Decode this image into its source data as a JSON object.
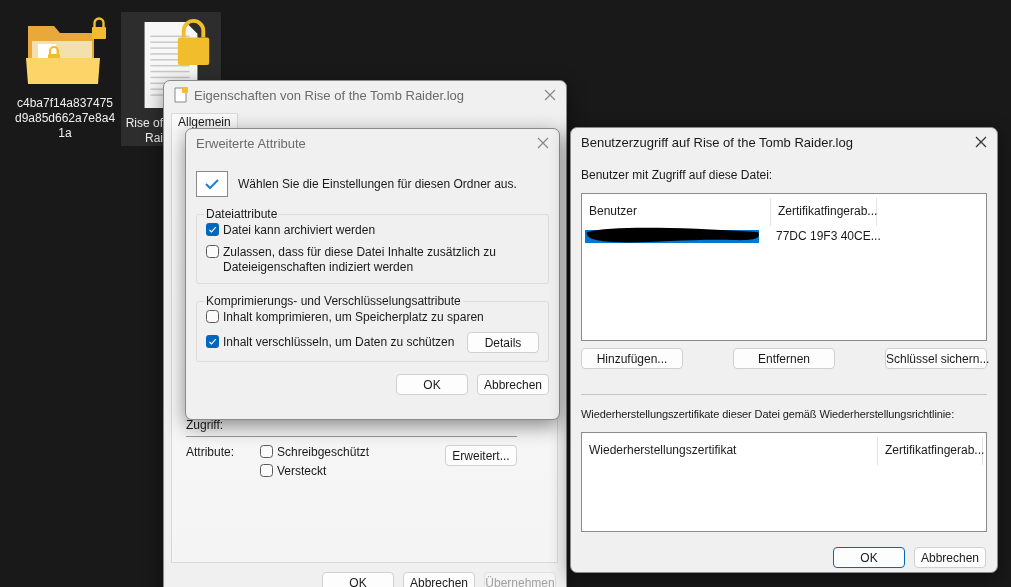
{
  "desktop": {
    "icons": [
      {
        "kind": "folder",
        "label_lines": [
          "c4ba7f14a837475",
          "d9a85d662a7e8a4",
          "1a"
        ],
        "selected": false
      },
      {
        "kind": "file",
        "label_lines": [
          "Rise of",
          "Rai"
        ],
        "selected": true
      }
    ]
  },
  "properties": {
    "title": "Eigenschaften von Rise of the Tomb Raider.log",
    "tabs": [
      {
        "label": "Allgemein",
        "selected": true
      }
    ],
    "access_label": "Zugriff:",
    "attributes_label": "Attribute:",
    "checkboxes": [
      {
        "label": "Schreibgeschützt",
        "checked": false
      },
      {
        "label": "Versteckt",
        "checked": false
      }
    ],
    "advanced_button": "Erweitert...",
    "buttons": [
      {
        "label": "OK",
        "disabled": false
      },
      {
        "label": "Abbrechen",
        "disabled": false
      },
      {
        "label": "Übernehmen",
        "disabled": true
      }
    ]
  },
  "advanced": {
    "title": "Erweiterte Attribute",
    "intro": "Wählen Sie die Einstellungen für diesen Ordner aus.",
    "groups": [
      {
        "title": "Dateiattribute",
        "options": [
          {
            "label": "Datei kann archiviert werden",
            "checked": true
          },
          {
            "label": "Zulassen, dass für diese Datei Inhalte zusätzlich zu Dateieigenschaften indiziert werden",
            "checked": false
          }
        ]
      },
      {
        "title": "Komprimierungs- und Verschlüsselungsattribute",
        "options": [
          {
            "label": "Inhalt komprimieren, um Speicherplatz zu sparen",
            "checked": false
          },
          {
            "label": "Inhalt verschlüsseln, um Daten zu schützen",
            "checked": true,
            "button": "Details"
          }
        ]
      }
    ],
    "buttons": [
      "OK",
      "Abbrechen"
    ]
  },
  "user_access": {
    "title": "Benutzerzugriff auf Rise of the Tomb Raider.log",
    "users_label": "Benutzer mit Zugriff auf diese Datei:",
    "users_table": {
      "columns": [
        "Benutzer",
        "Zertifikatfingerab..."
      ],
      "rows": [
        {
          "redacted": true,
          "fingerprint": "77DC 19F3 40CE...",
          "selected": true
        }
      ]
    },
    "actions": [
      "Hinzufügen...",
      "Entfernen",
      "Schlüssel sichern..."
    ],
    "recovery_label": "Wiederherstellungszertifikate dieser Datei gemäß Wiederherstellungsrichtlinie:",
    "recovery_table": {
      "columns": [
        "Wiederherstellungszertifikat",
        "Zertifikatfingerab..."
      ]
    },
    "buttons": [
      {
        "label": "OK",
        "default": true
      },
      {
        "label": "Abbrechen",
        "default": false
      }
    ]
  }
}
